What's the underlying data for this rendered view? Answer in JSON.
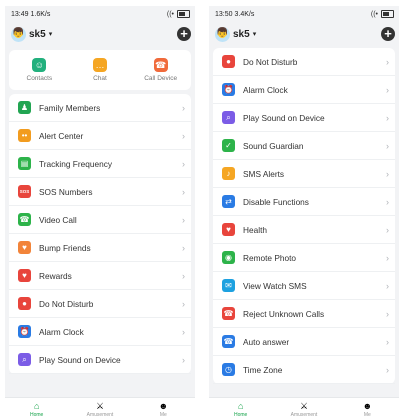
{
  "left": {
    "status": {
      "time": "13:49",
      "speed": "1.6K/s",
      "signal": "((•",
      "battery": ""
    },
    "user": {
      "name": "sk5",
      "caret": "▾",
      "avatar": "👦"
    },
    "add_label": "+",
    "quick": [
      {
        "label": "Contacts",
        "icon": "contacts-icon",
        "glyph": "☺",
        "color": "#22b07d"
      },
      {
        "label": "Chat",
        "icon": "chat-icon",
        "glyph": "…",
        "color": "#f5a623"
      },
      {
        "label": "Call Device",
        "icon": "call-device-icon",
        "glyph": "☎",
        "color": "#f06a3b"
      }
    ],
    "items": [
      {
        "label": "Family Members",
        "icon": "family-members-icon",
        "glyph": "♟",
        "color": "#22a552"
      },
      {
        "label": "Alert Center",
        "icon": "alert-center-icon",
        "glyph": "••",
        "color": "#f29c1f"
      },
      {
        "label": "Tracking Frequency",
        "icon": "tracking-frequency-icon",
        "glyph": "▤",
        "color": "#2db34a"
      },
      {
        "label": "SOS Numbers",
        "icon": "sos-icon",
        "glyph": "SOS",
        "color": "#e8453c"
      },
      {
        "label": "Video Call",
        "icon": "video-call-icon",
        "glyph": "☎",
        "color": "#2db34a"
      },
      {
        "label": "Bump Friends",
        "icon": "bump-friends-icon",
        "glyph": "♥",
        "color": "#f2843a"
      },
      {
        "label": "Rewards",
        "icon": "rewards-icon",
        "glyph": "♥",
        "color": "#e8453c"
      },
      {
        "label": "Do Not Disturb",
        "icon": "do-not-disturb-icon",
        "glyph": "●",
        "color": "#e8453c"
      },
      {
        "label": "Alarm Clock",
        "icon": "alarm-clock-icon",
        "glyph": "⏰",
        "color": "#2a7be4"
      },
      {
        "label": "Play Sound on Device",
        "icon": "play-sound-icon",
        "glyph": "⌕",
        "color": "#7b5ce6"
      }
    ],
    "tabs": [
      {
        "label": "Home",
        "icon": "home-icon",
        "glyph": "⌂",
        "active": true
      },
      {
        "label": "Amusement",
        "icon": "amusement-icon",
        "glyph": "⚔",
        "active": false
      },
      {
        "label": "Me",
        "icon": "me-icon",
        "glyph": "☻",
        "active": false
      }
    ]
  },
  "right": {
    "status": {
      "time": "13:50",
      "speed": "3.4K/s",
      "signal": "((•",
      "battery": ""
    },
    "user": {
      "name": "sk5",
      "caret": "▾",
      "avatar": "👦"
    },
    "add_label": "+",
    "items": [
      {
        "label": "Do Not Disturb",
        "icon": "do-not-disturb-icon",
        "glyph": "●",
        "color": "#e8453c"
      },
      {
        "label": "Alarm Clock",
        "icon": "alarm-clock-icon",
        "glyph": "⏰",
        "color": "#2a7be4"
      },
      {
        "label": "Play Sound on Device",
        "icon": "play-sound-icon",
        "glyph": "⌕",
        "color": "#7b5ce6"
      },
      {
        "label": "Sound Guardian",
        "icon": "sound-guardian-icon",
        "glyph": "✓",
        "color": "#2db34a"
      },
      {
        "label": "SMS Alerts",
        "icon": "sms-alerts-icon",
        "glyph": "♪",
        "color": "#f5a623"
      },
      {
        "label": "Disable Functions",
        "icon": "disable-functions-icon",
        "glyph": "⇄",
        "color": "#2a7be4"
      },
      {
        "label": "Health",
        "icon": "health-icon",
        "glyph": "♥",
        "color": "#e8453c"
      },
      {
        "label": "Remote Photo",
        "icon": "remote-photo-icon",
        "glyph": "◉",
        "color": "#2db34a"
      },
      {
        "label": "View Watch SMS",
        "icon": "view-watch-sms-icon",
        "glyph": "✉",
        "color": "#1da1e0"
      },
      {
        "label": "Reject Unknown Calls",
        "icon": "reject-calls-icon",
        "glyph": "☎",
        "color": "#e8453c"
      },
      {
        "label": "Auto answer",
        "icon": "auto-answer-icon",
        "glyph": "☎",
        "color": "#2a7be4"
      },
      {
        "label": "Time Zone",
        "icon": "time-zone-icon",
        "glyph": "◷",
        "color": "#2a7be4"
      }
    ],
    "tabs": [
      {
        "label": "Home",
        "icon": "home-icon",
        "glyph": "⌂",
        "active": true
      },
      {
        "label": "Amusement",
        "icon": "amusement-icon",
        "glyph": "⚔",
        "active": false
      },
      {
        "label": "Me",
        "icon": "me-icon",
        "glyph": "☻",
        "active": false
      }
    ]
  },
  "chevron": "›"
}
